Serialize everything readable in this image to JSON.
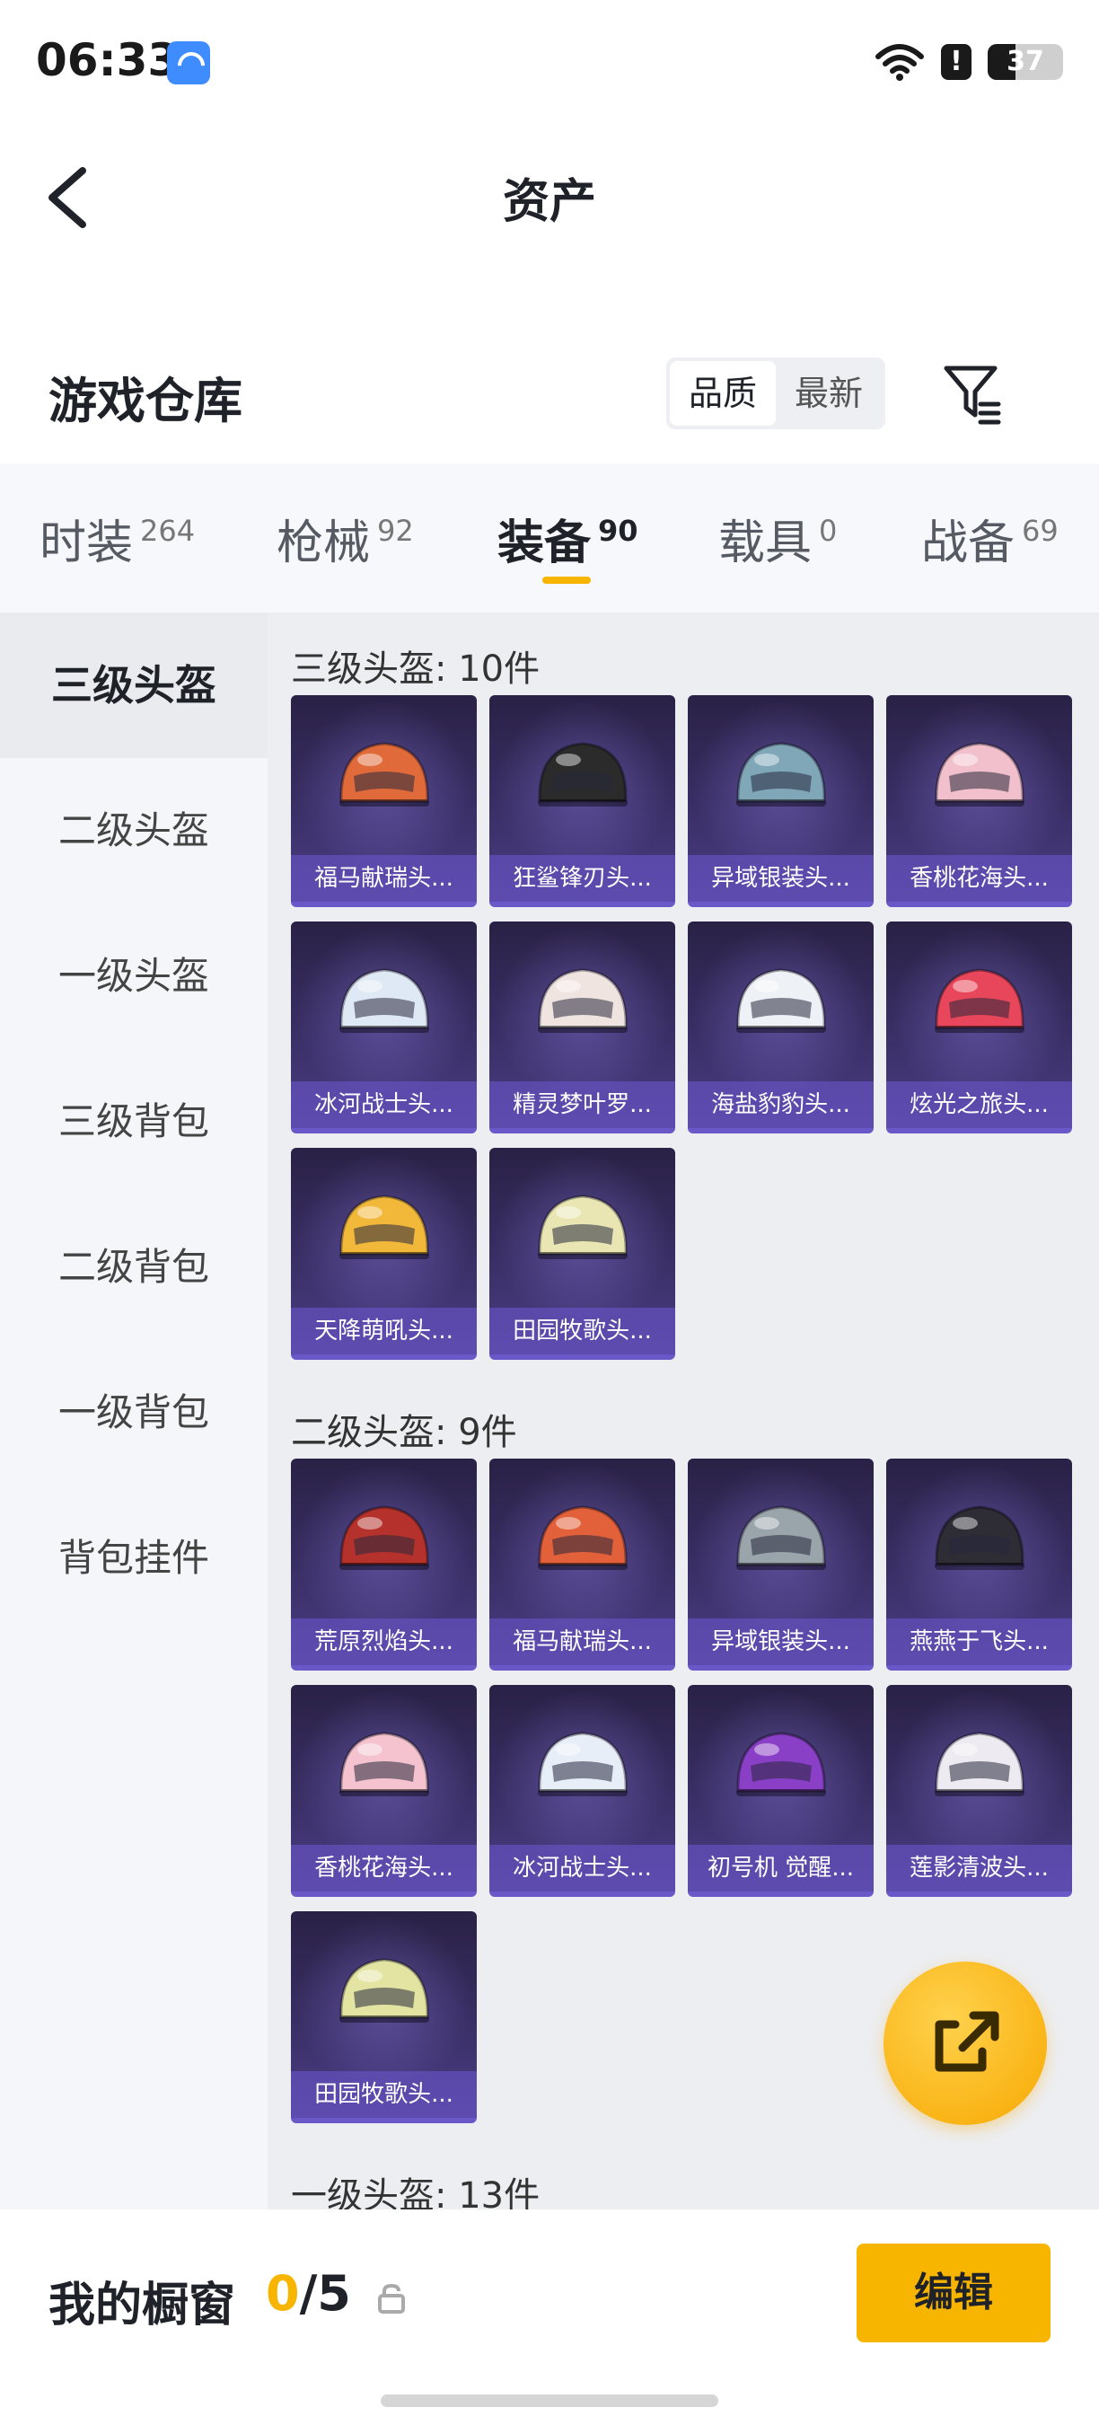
{
  "status_bar": {
    "time": "06:33",
    "battery": "37",
    "battery_level": 0.37
  },
  "header": {
    "title": "资产"
  },
  "warehouse": {
    "title": "游戏仓库",
    "sort_options": [
      "品质",
      "最新"
    ],
    "active_sort": "品质"
  },
  "tabs": [
    {
      "label": "时装",
      "count": "264"
    },
    {
      "label": "枪械",
      "count": "92"
    },
    {
      "label": "装备",
      "count": "90",
      "active": true
    },
    {
      "label": "载具",
      "count": "0"
    },
    {
      "label": "战备",
      "count": "69"
    }
  ],
  "sidebar": {
    "items": [
      {
        "label": "三级头盔",
        "active": true
      },
      {
        "label": "二级头盔"
      },
      {
        "label": "一级头盔"
      },
      {
        "label": "三级背包"
      },
      {
        "label": "二级背包"
      },
      {
        "label": "一级背包"
      },
      {
        "label": "背包挂件"
      }
    ]
  },
  "groups": [
    {
      "title": "三级头盔: 10件",
      "items": [
        {
          "name": "福马献瑞头...",
          "color": "#e06a3a"
        },
        {
          "name": "狂鲨锋刃头...",
          "color": "#2b2b2b"
        },
        {
          "name": "异域银装头...",
          "color": "#7fa7b8"
        },
        {
          "name": "香桃花海头...",
          "color": "#f2c0cc"
        },
        {
          "name": "冰河战士头...",
          "color": "#dfe9f5"
        },
        {
          "name": "精灵梦叶罗...",
          "color": "#f0e4e0"
        },
        {
          "name": "海盐豹豹头...",
          "color": "#eef2f6"
        },
        {
          "name": "炫光之旅头...",
          "color": "#e8465a"
        },
        {
          "name": "天降萌吼头...",
          "color": "#f2b83a"
        },
        {
          "name": "田园牧歌头...",
          "color": "#e9e6b4"
        }
      ]
    },
    {
      "title": "二级头盔: 9件",
      "items": [
        {
          "name": "荒原烈焰头...",
          "color": "#b5322c"
        },
        {
          "name": "福马献瑞头...",
          "color": "#e2603a"
        },
        {
          "name": "异域银装头...",
          "color": "#9aa4ab"
        },
        {
          "name": "燕燕于飞头...",
          "color": "#2e2c35"
        },
        {
          "name": "香桃花海头...",
          "color": "#f4c3cf"
        },
        {
          "name": "冰河战士头...",
          "color": "#e7eef8"
        },
        {
          "name": "初号机 觉醒...",
          "color": "#8a3fc7"
        },
        {
          "name": "莲影清波头...",
          "color": "#eeeaf1"
        },
        {
          "name": "田园牧歌头...",
          "color": "#e3e3a2"
        }
      ]
    },
    {
      "title": "一级头盔: 13件",
      "items": []
    }
  ],
  "showcase": {
    "title": "我的橱窗",
    "current": "0",
    "total": "/5",
    "edit_label": "编辑"
  },
  "colors": {
    "accent": "#f7b500",
    "card_bg": "#3a2f66"
  }
}
